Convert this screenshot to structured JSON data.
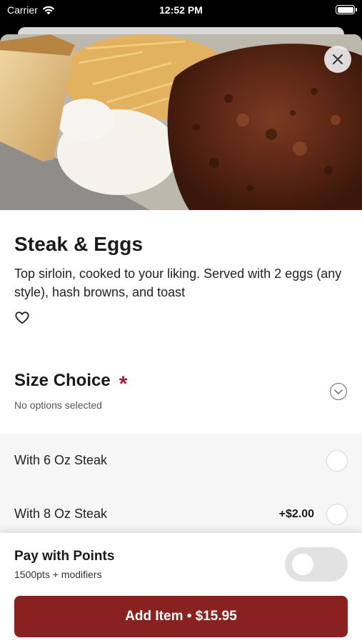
{
  "status_bar": {
    "carrier": "Carrier",
    "time": "12:52 PM",
    "icons": [
      "wifi-icon",
      "battery-icon"
    ]
  },
  "item": {
    "title": "Steak & Eggs",
    "description": "Top sirloin, cooked to your liking. Served with 2 eggs (any style), hash browns, and toast",
    "icons": [
      "close-icon",
      "heart-icon"
    ]
  },
  "size_choice": {
    "title": "Size Choice",
    "required_mark": "*",
    "subtitle": "No options selected",
    "icon": "chevron-down-icon",
    "options": [
      {
        "label": "With 6 Oz Steak",
        "price": ""
      },
      {
        "label": "With 8 Oz Steak",
        "price": "+$2.00"
      }
    ]
  },
  "points": {
    "title": "Pay with Points",
    "subtitle": "1500pts + modifiers",
    "enabled": false
  },
  "add_button": {
    "label": "Add Item • $15.95"
  },
  "colors": {
    "accent": "#8a2121",
    "required": "#a11d3c"
  }
}
